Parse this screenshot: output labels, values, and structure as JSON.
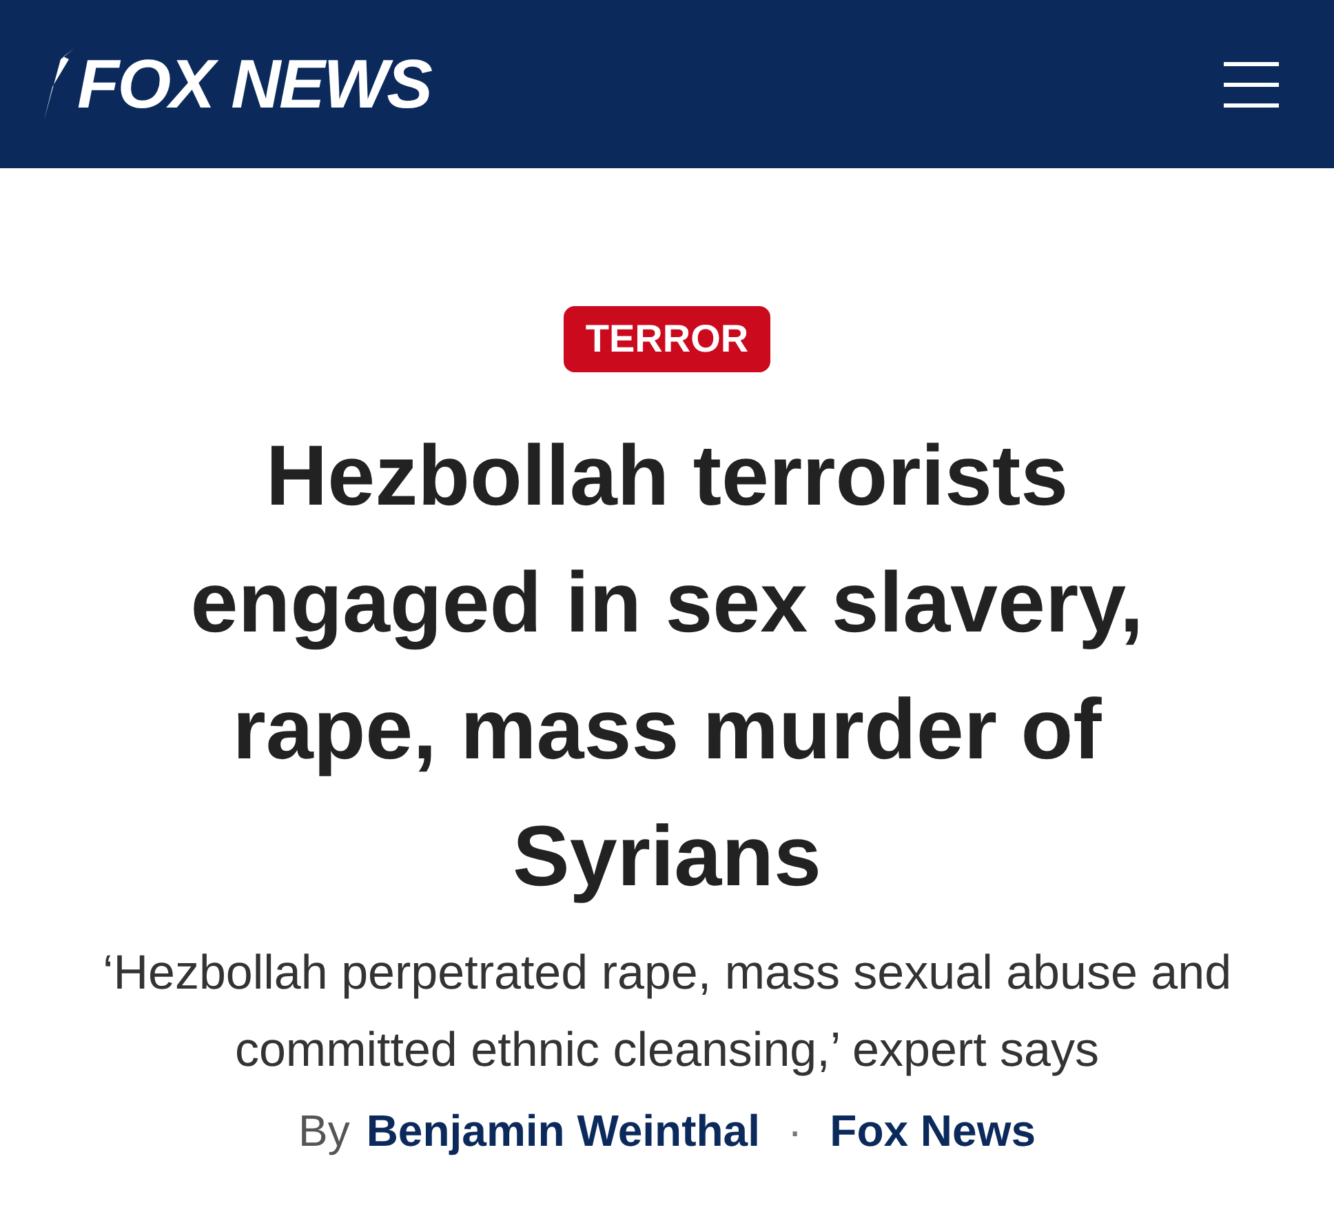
{
  "header": {
    "logo": "FOX NEWS"
  },
  "article": {
    "category": "TERROR",
    "headline": "Hezbollah terrorists engaged in sex slavery, rape, mass murder of Syrians",
    "subheadline": "‘Hezbollah perpetrated rape, mass sexual abuse and committed ethnic cleansing,’ expert says",
    "byline": {
      "prefix": "By",
      "author": "Benjamin Weinthal",
      "separator": "·",
      "source": "Fox News"
    }
  }
}
